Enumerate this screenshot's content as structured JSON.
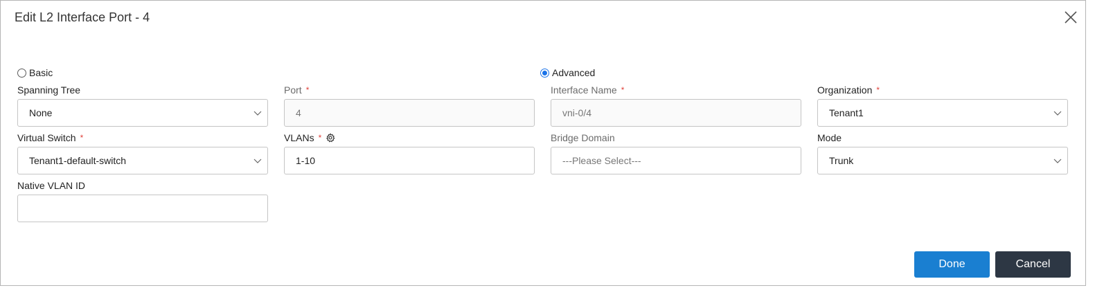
{
  "dialog": {
    "title": "Edit L2 Interface Port - 4"
  },
  "mode_selector": {
    "basic_label": "Basic",
    "advanced_label": "Advanced",
    "selected": "Advanced"
  },
  "fields": {
    "spanning_tree": {
      "label": "Spanning Tree",
      "value": "None"
    },
    "port": {
      "label": "Port",
      "value": "4",
      "required_mark": "*"
    },
    "interface_name": {
      "label": "Interface Name",
      "value": "vni-0/4",
      "required_mark": "*"
    },
    "organization": {
      "label": "Organization",
      "value": "Tenant1",
      "required_mark": "*"
    },
    "virtual_switch": {
      "label": "Virtual Switch",
      "value": "Tenant1-default-switch",
      "required_mark": "*"
    },
    "vlans": {
      "label": "VLANs",
      "value": "1-10",
      "required_mark": "*"
    },
    "bridge_domain": {
      "label": "Bridge Domain",
      "placeholder": "---Please Select---"
    },
    "mode": {
      "label": "Mode",
      "value": "Trunk"
    },
    "native_vlan_id": {
      "label": "Native VLAN ID",
      "value": ""
    }
  },
  "buttons": {
    "done": "Done",
    "cancel": "Cancel"
  },
  "colors": {
    "primary": "#1a7fd1",
    "secondary": "#2d3744",
    "required": "#e0413a",
    "radio_accent": "#1a73e8"
  }
}
